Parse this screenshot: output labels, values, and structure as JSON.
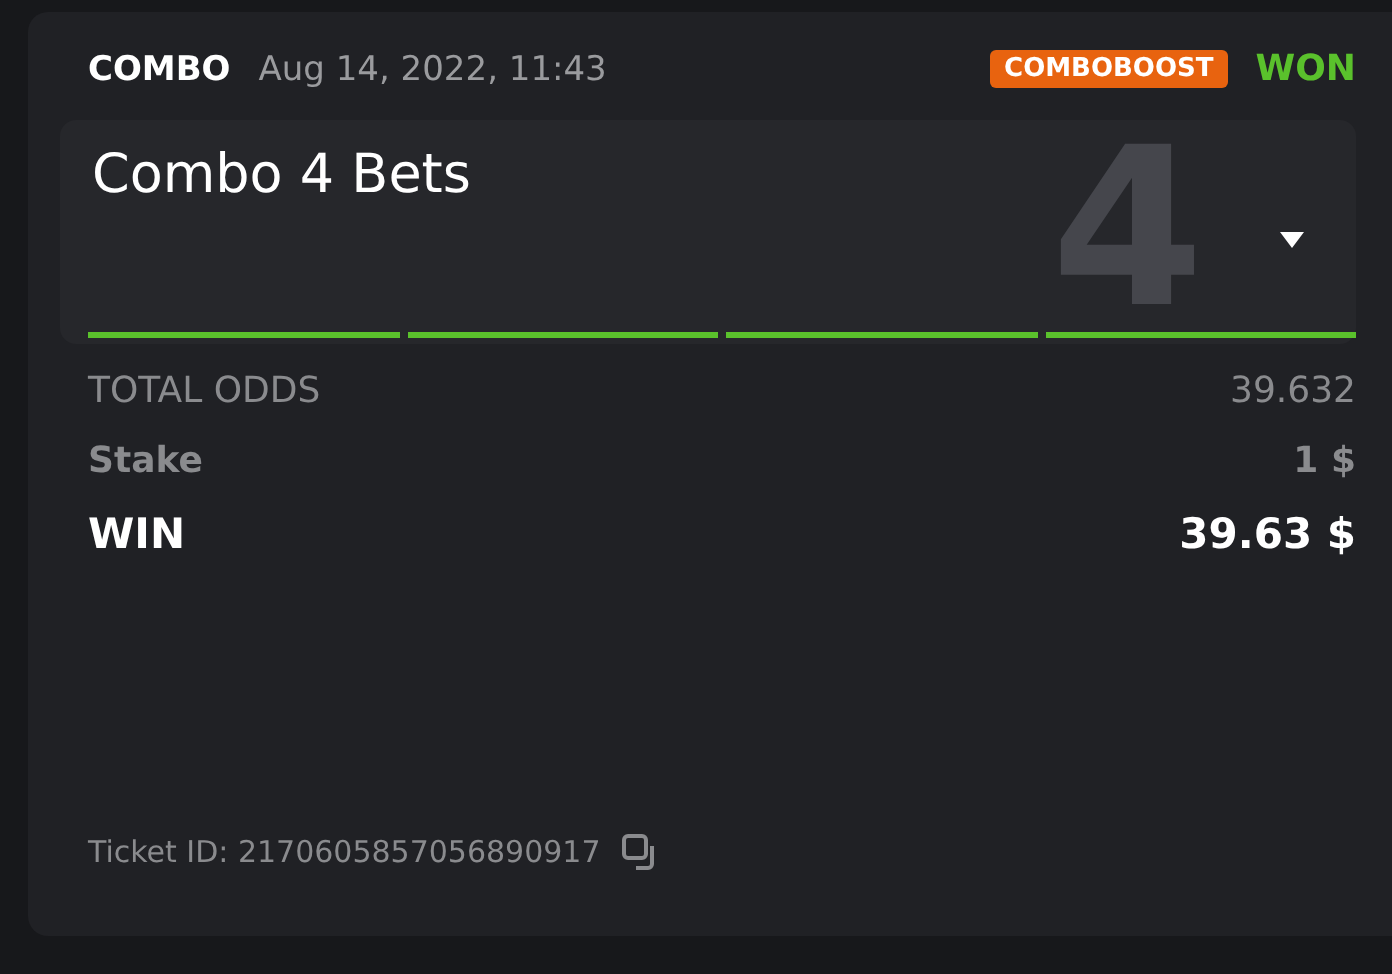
{
  "header": {
    "type": "COMBO",
    "date": "Aug 14, 2022, 11:43",
    "badge": "COMBOBOOST",
    "result": "WON"
  },
  "bet": {
    "title": "Combo 4 Bets",
    "count": "4",
    "expanded": false,
    "legs": [
      {
        "won": true
      },
      {
        "won": true
      },
      {
        "won": true
      },
      {
        "won": true
      }
    ]
  },
  "rows": [
    {
      "kind": "odds",
      "label": "TOTAL ODDS",
      "value": "39.632"
    },
    {
      "kind": "stake",
      "label": "Stake",
      "value": "1 $"
    },
    {
      "kind": "win",
      "label": "WIN",
      "value": "39.63 $"
    }
  ],
  "ticket": {
    "text": "Ticket ID: 2170605857056890917"
  }
}
